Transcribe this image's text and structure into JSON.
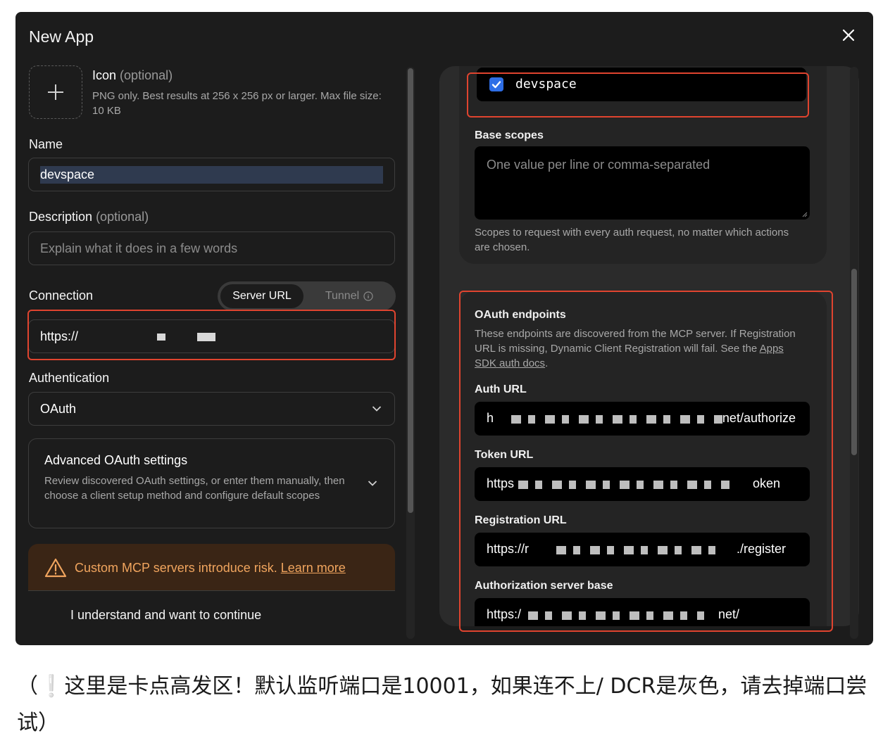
{
  "dialog": {
    "title": "New App",
    "icon_field": {
      "label": "Icon",
      "optional": "(optional)",
      "help": "PNG only. Best results at 256 x 256 px or larger. Max file size: 10 KB"
    },
    "name": {
      "label": "Name",
      "value": "devspace"
    },
    "description": {
      "label": "Description",
      "optional": "(optional)",
      "placeholder": "Explain what it does in a few words"
    },
    "connection": {
      "label": "Connection",
      "options": [
        "Server URL",
        "Tunnel"
      ],
      "selected": "Server URL",
      "value": "https://"
    },
    "authentication": {
      "label": "Authentication",
      "value": "OAuth"
    },
    "advanced": {
      "title": "Advanced OAuth settings",
      "description": "Review discovered OAuth settings, or enter them manually, then choose a client setup method and configure default scopes"
    },
    "warning": {
      "text": "Custom MCP servers introduce risk.",
      "link": "Learn more",
      "confirm": "I understand and want to continue"
    }
  },
  "right_panel": {
    "scope_item": {
      "label": "devspace",
      "checked": true
    },
    "base_scopes": {
      "label": "Base scopes",
      "placeholder": "One value per line or comma-separated",
      "help": "Scopes to request with every auth request, no matter which actions are chosen."
    },
    "oauth": {
      "title": "OAuth endpoints",
      "description": "These endpoints are discovered from the MCP server. If Registration URL is missing, Dynamic Client Registration will fail. See the",
      "link": "Apps SDK auth docs",
      "fields": [
        {
          "label": "Auth URL",
          "prefix": "h",
          "suffix": "net/authorize"
        },
        {
          "label": "Token URL",
          "prefix": "https",
          "suffix": "oken"
        },
        {
          "label": "Registration URL",
          "prefix": "https://r",
          "suffix": "./register"
        },
        {
          "label": "Authorization server base",
          "prefix": "https:/",
          "suffix": "net/"
        }
      ]
    }
  },
  "caption": "（❕这里是卡点高发区！默认监听端口是10001，如果连不上/ DCR是灰色，请去掉端口尝试）",
  "colors": {
    "highlight": "#e0442f",
    "warning": "#f1a55e",
    "checkbox": "#2e6ee6"
  }
}
